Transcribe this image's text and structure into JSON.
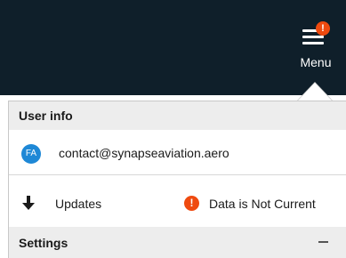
{
  "header": {
    "menu_label": "Menu",
    "notification_badge": "!"
  },
  "panel": {
    "user_info": {
      "title": "User info",
      "avatar_initials": "FA",
      "email": "contact@synapseaviation.aero"
    },
    "status": {
      "updates_label": "Updates",
      "data_status_icon": "!",
      "data_status_text": "Data is Not Current"
    },
    "settings": {
      "title": "Settings",
      "collapse_symbol": "—"
    }
  },
  "icons": {
    "menu": "hamburger-icon",
    "notification": "alert-badge-icon",
    "updates": "download-arrow-icon",
    "data_status": "alert-icon",
    "collapse": "minus-icon"
  },
  "colors": {
    "topbar": "#0f1f2a",
    "alert": "#ef4a0f",
    "avatar": "#1e88d6",
    "section_header": "#ededed"
  }
}
